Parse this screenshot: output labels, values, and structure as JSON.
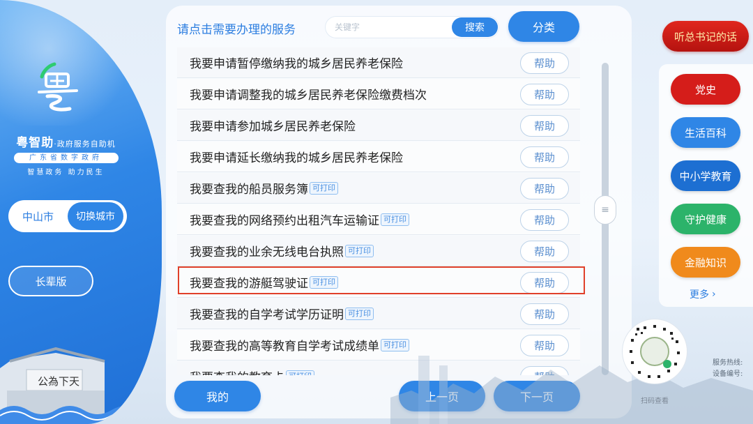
{
  "colors": {
    "primary": "#2f86e6",
    "highlight_border": "#e0402a",
    "quote_red": "#c41b14",
    "party_red": "#d51d1a",
    "life_blue": "#2f86e6",
    "edu_blue": "#1d6fd2",
    "health_green": "#2cb36a",
    "finance_orange": "#f08a1c"
  },
  "sidebar": {
    "logo_icon": "yue-calligraphy-icon",
    "brand_title": "粤智助",
    "brand_title_suffix": "·政府服务自助机",
    "brand_sub": "广东省数字政府",
    "brand_slogan": "智慧政务 助力民生",
    "city_name": "中山市",
    "switch_city_label": "切换城市",
    "elder_mode_label": "长辈版"
  },
  "header": {
    "title": "请点击需要办理的服务",
    "search_placeholder": "关键字",
    "search_label": "搜索",
    "category_label": "分类"
  },
  "services": [
    {
      "name": "我要申请暂停缴纳我的城乡居民养老保险",
      "printable": false,
      "help": "帮助"
    },
    {
      "name": "我要申请调整我的城乡居民养老保险缴费档次",
      "printable": false,
      "help": "帮助"
    },
    {
      "name": "我要申请参加城乡居民养老保险",
      "printable": false,
      "help": "帮助"
    },
    {
      "name": "我要申请延长缴纳我的城乡居民养老保险",
      "printable": false,
      "help": "帮助"
    },
    {
      "name": "我要查我的船员服务簿",
      "printable": true,
      "help": "帮助"
    },
    {
      "name": "我要查我的网络预约出租汽车运输证",
      "printable": true,
      "help": "帮助"
    },
    {
      "name": "我要查我的业余无线电台执照",
      "printable": true,
      "help": "帮助"
    },
    {
      "name": "我要查我的游艇驾驶证",
      "printable": true,
      "help": "帮助",
      "highlighted": true
    },
    {
      "name": "我要查我的自学考试学历证明",
      "printable": true,
      "help": "帮助"
    },
    {
      "name": "我要查我的高等教育自学考试成绩单",
      "printable": true,
      "help": "帮助"
    },
    {
      "name": "我要查我的教育卡",
      "printable": true,
      "help": "帮助"
    }
  ],
  "print_tag_label": "可打印",
  "footer": {
    "mine_label": "我的",
    "prev_label": "上一页",
    "next_label": "下一页"
  },
  "right": {
    "quote_label": "听总书记的话",
    "categories": [
      {
        "label": "党史",
        "color": "#d51d1a"
      },
      {
        "label": "生活百科",
        "color": "#2f86e6"
      },
      {
        "label": "中小学教育",
        "color": "#1d6fd2"
      },
      {
        "label": "守护健康",
        "color": "#2cb36a"
      },
      {
        "label": "金融知识",
        "color": "#f08a1c"
      }
    ],
    "more_label": "更多",
    "qr_label": "扫码查看",
    "hotline_label": "服务热线:",
    "device_label": "设备编号:"
  }
}
